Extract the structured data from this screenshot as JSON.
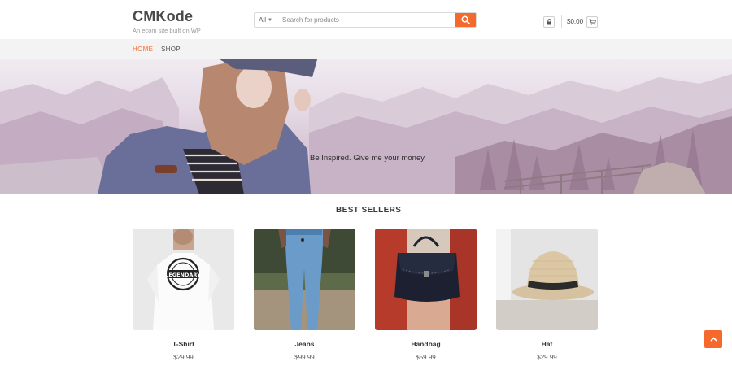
{
  "header": {
    "site_title": "CMKode",
    "tagline": "An ecom site built on WP",
    "search": {
      "category": "All",
      "placeholder": "Search for products"
    },
    "cart_total": "$0.00"
  },
  "nav": {
    "items": [
      {
        "label": "HOME",
        "active": true
      },
      {
        "label": "SHOP",
        "active": false
      }
    ]
  },
  "hero": {
    "text": "Be Inspired. Give me your money."
  },
  "best_sellers": {
    "title": "BEST SELLERS",
    "products": [
      {
        "name": "T-Shirt",
        "price": "$29.99"
      },
      {
        "name": "Jeans",
        "price": "$99.99"
      },
      {
        "name": "Handbag",
        "price": "$59.99"
      },
      {
        "name": "Hat",
        "price": "$29.99"
      }
    ]
  },
  "icons": {
    "search": "search-icon",
    "lock": "lock-icon",
    "cart": "cart-icon",
    "scroll_top": "chevron-up-icon"
  },
  "colors": {
    "accent": "#f5692c",
    "nav_bg": "#f3f3f3",
    "title": "#4a4a4a"
  }
}
